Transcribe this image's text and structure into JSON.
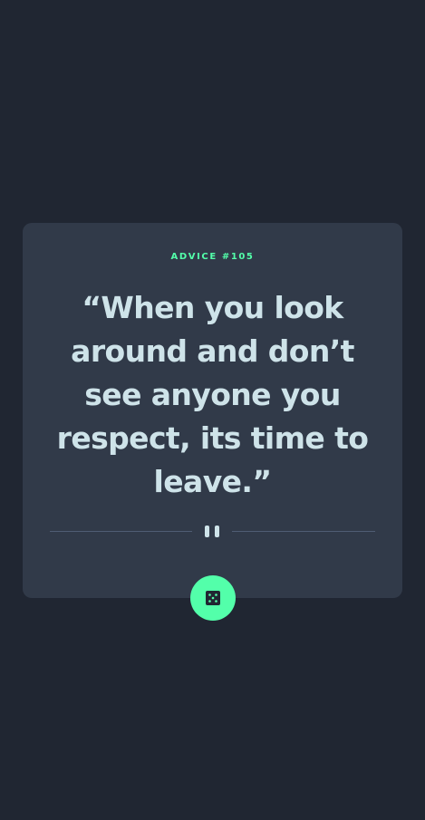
{
  "advice": {
    "id_label": "ADVICE #105",
    "quote": "“When you look around and don’t see anyone you respect, its time to leave.”"
  },
  "icons": {
    "divider": "pause-icon",
    "button": "dice-icon"
  },
  "colors": {
    "background": "#202632",
    "card": "#313a49",
    "accent": "#53ffaa",
    "text": "#cee3e9",
    "divider": "#4f5d74"
  }
}
